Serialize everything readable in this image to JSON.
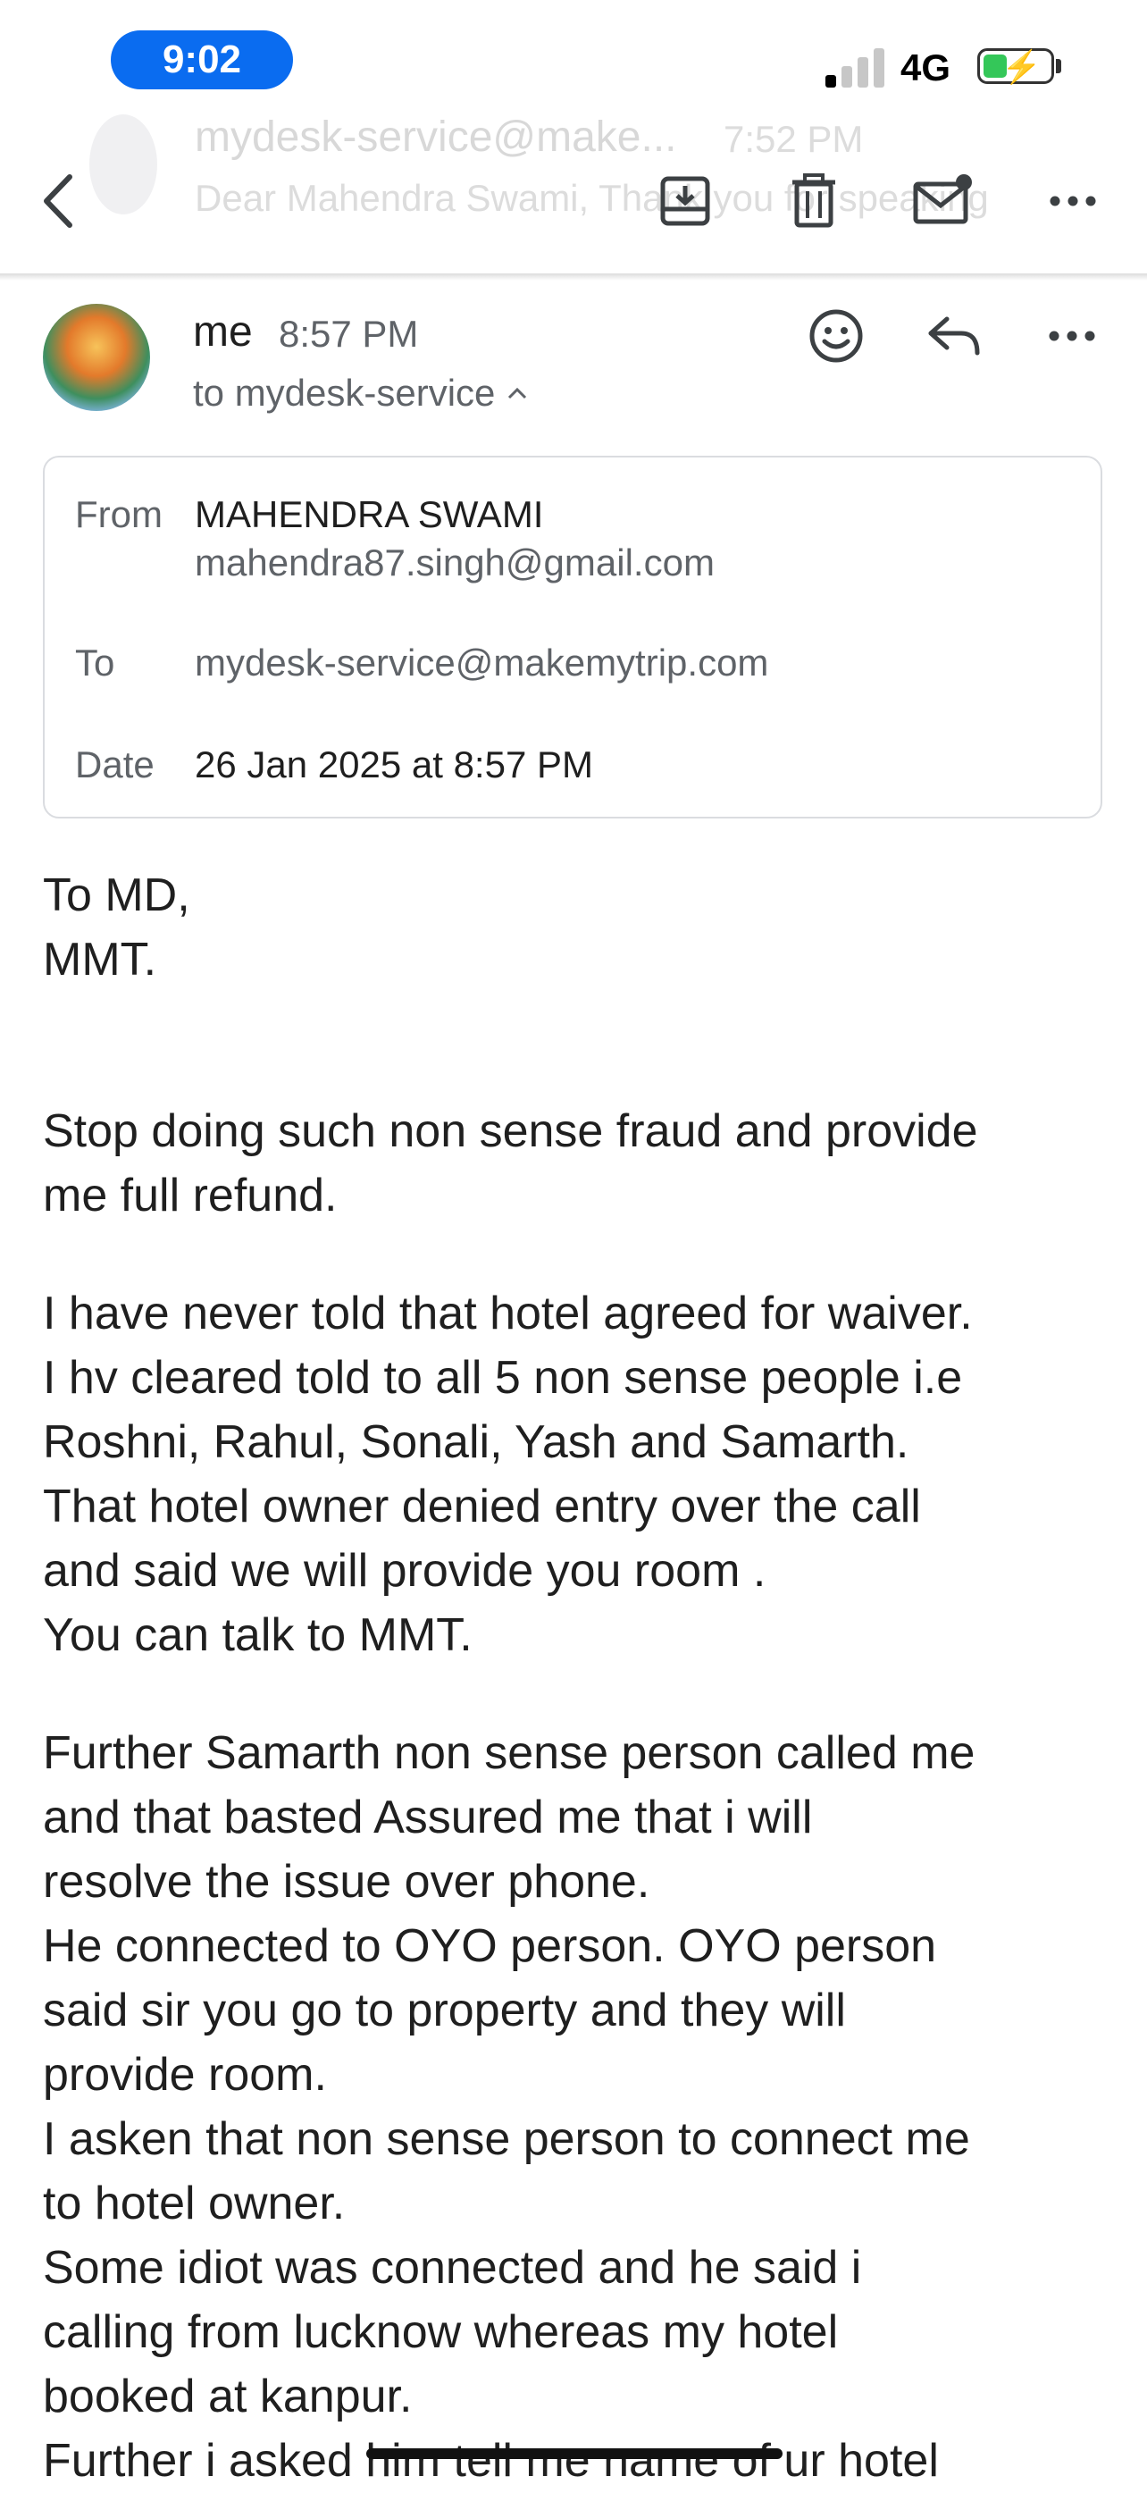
{
  "status_bar": {
    "time": "9:02",
    "network": "4G",
    "signal_bars_active": 1,
    "signal_bars_total": 4,
    "battery_level": 0.35,
    "battery_color": "#34c759"
  },
  "previous_message": {
    "sender": "mydesk-service@make...",
    "time": "7:52 PM",
    "preview": "Dear Mahendra Swami, Thank you for speaking"
  },
  "toolbar": {
    "back_icon": "chevron-left-icon",
    "archive_icon": "archive-icon",
    "delete_icon": "trash-icon",
    "mark_unread_icon": "mail-unread-icon",
    "more_icon": "more-horizontal-icon"
  },
  "message": {
    "sender": "me",
    "time": "8:57 PM",
    "recipient_summary": "to mydesk-service",
    "icons": [
      "emoji-reaction-icon",
      "reply-icon",
      "more-horizontal-icon"
    ]
  },
  "details": {
    "from_label": "From",
    "from_name": "MAHENDRA SWAMI",
    "from_email": "mahendra87.singh@gmail.com",
    "to_label": "To",
    "to_value": "mydesk-service@makemytrip.com",
    "date_label": "Date",
    "date_value": "26 Jan 2025 at 8:57 PM"
  },
  "body": {
    "salutation": "To MD,\nMMT.",
    "para1": "Stop doing such non sense fraud and provide\nme full refund.",
    "para2": "I have never told that hotel agreed for waiver.\nI hv cleared told to all 5 non sense people i.e\nRoshni, Rahul, Sonali, Yash and Samarth.\nThat hotel owner denied entry over the call\nand said we will provide you room .\nYou can talk to MMT.",
    "para3": "Further Samarth non sense person called me\nand that basted     Assured me that i will\nresolve the issue over phone.\nHe connected to OYO person. OYO person\nsaid sir you go to property and they will\nprovide room.\nI asken that non sense person to connect me\nto hotel owner.\nSome idiot was connected and he said i\ncalling from lucknow whereas my hotel\nbooked at kanpur.\nFurther i asked him tell me name of ur hotel"
  }
}
